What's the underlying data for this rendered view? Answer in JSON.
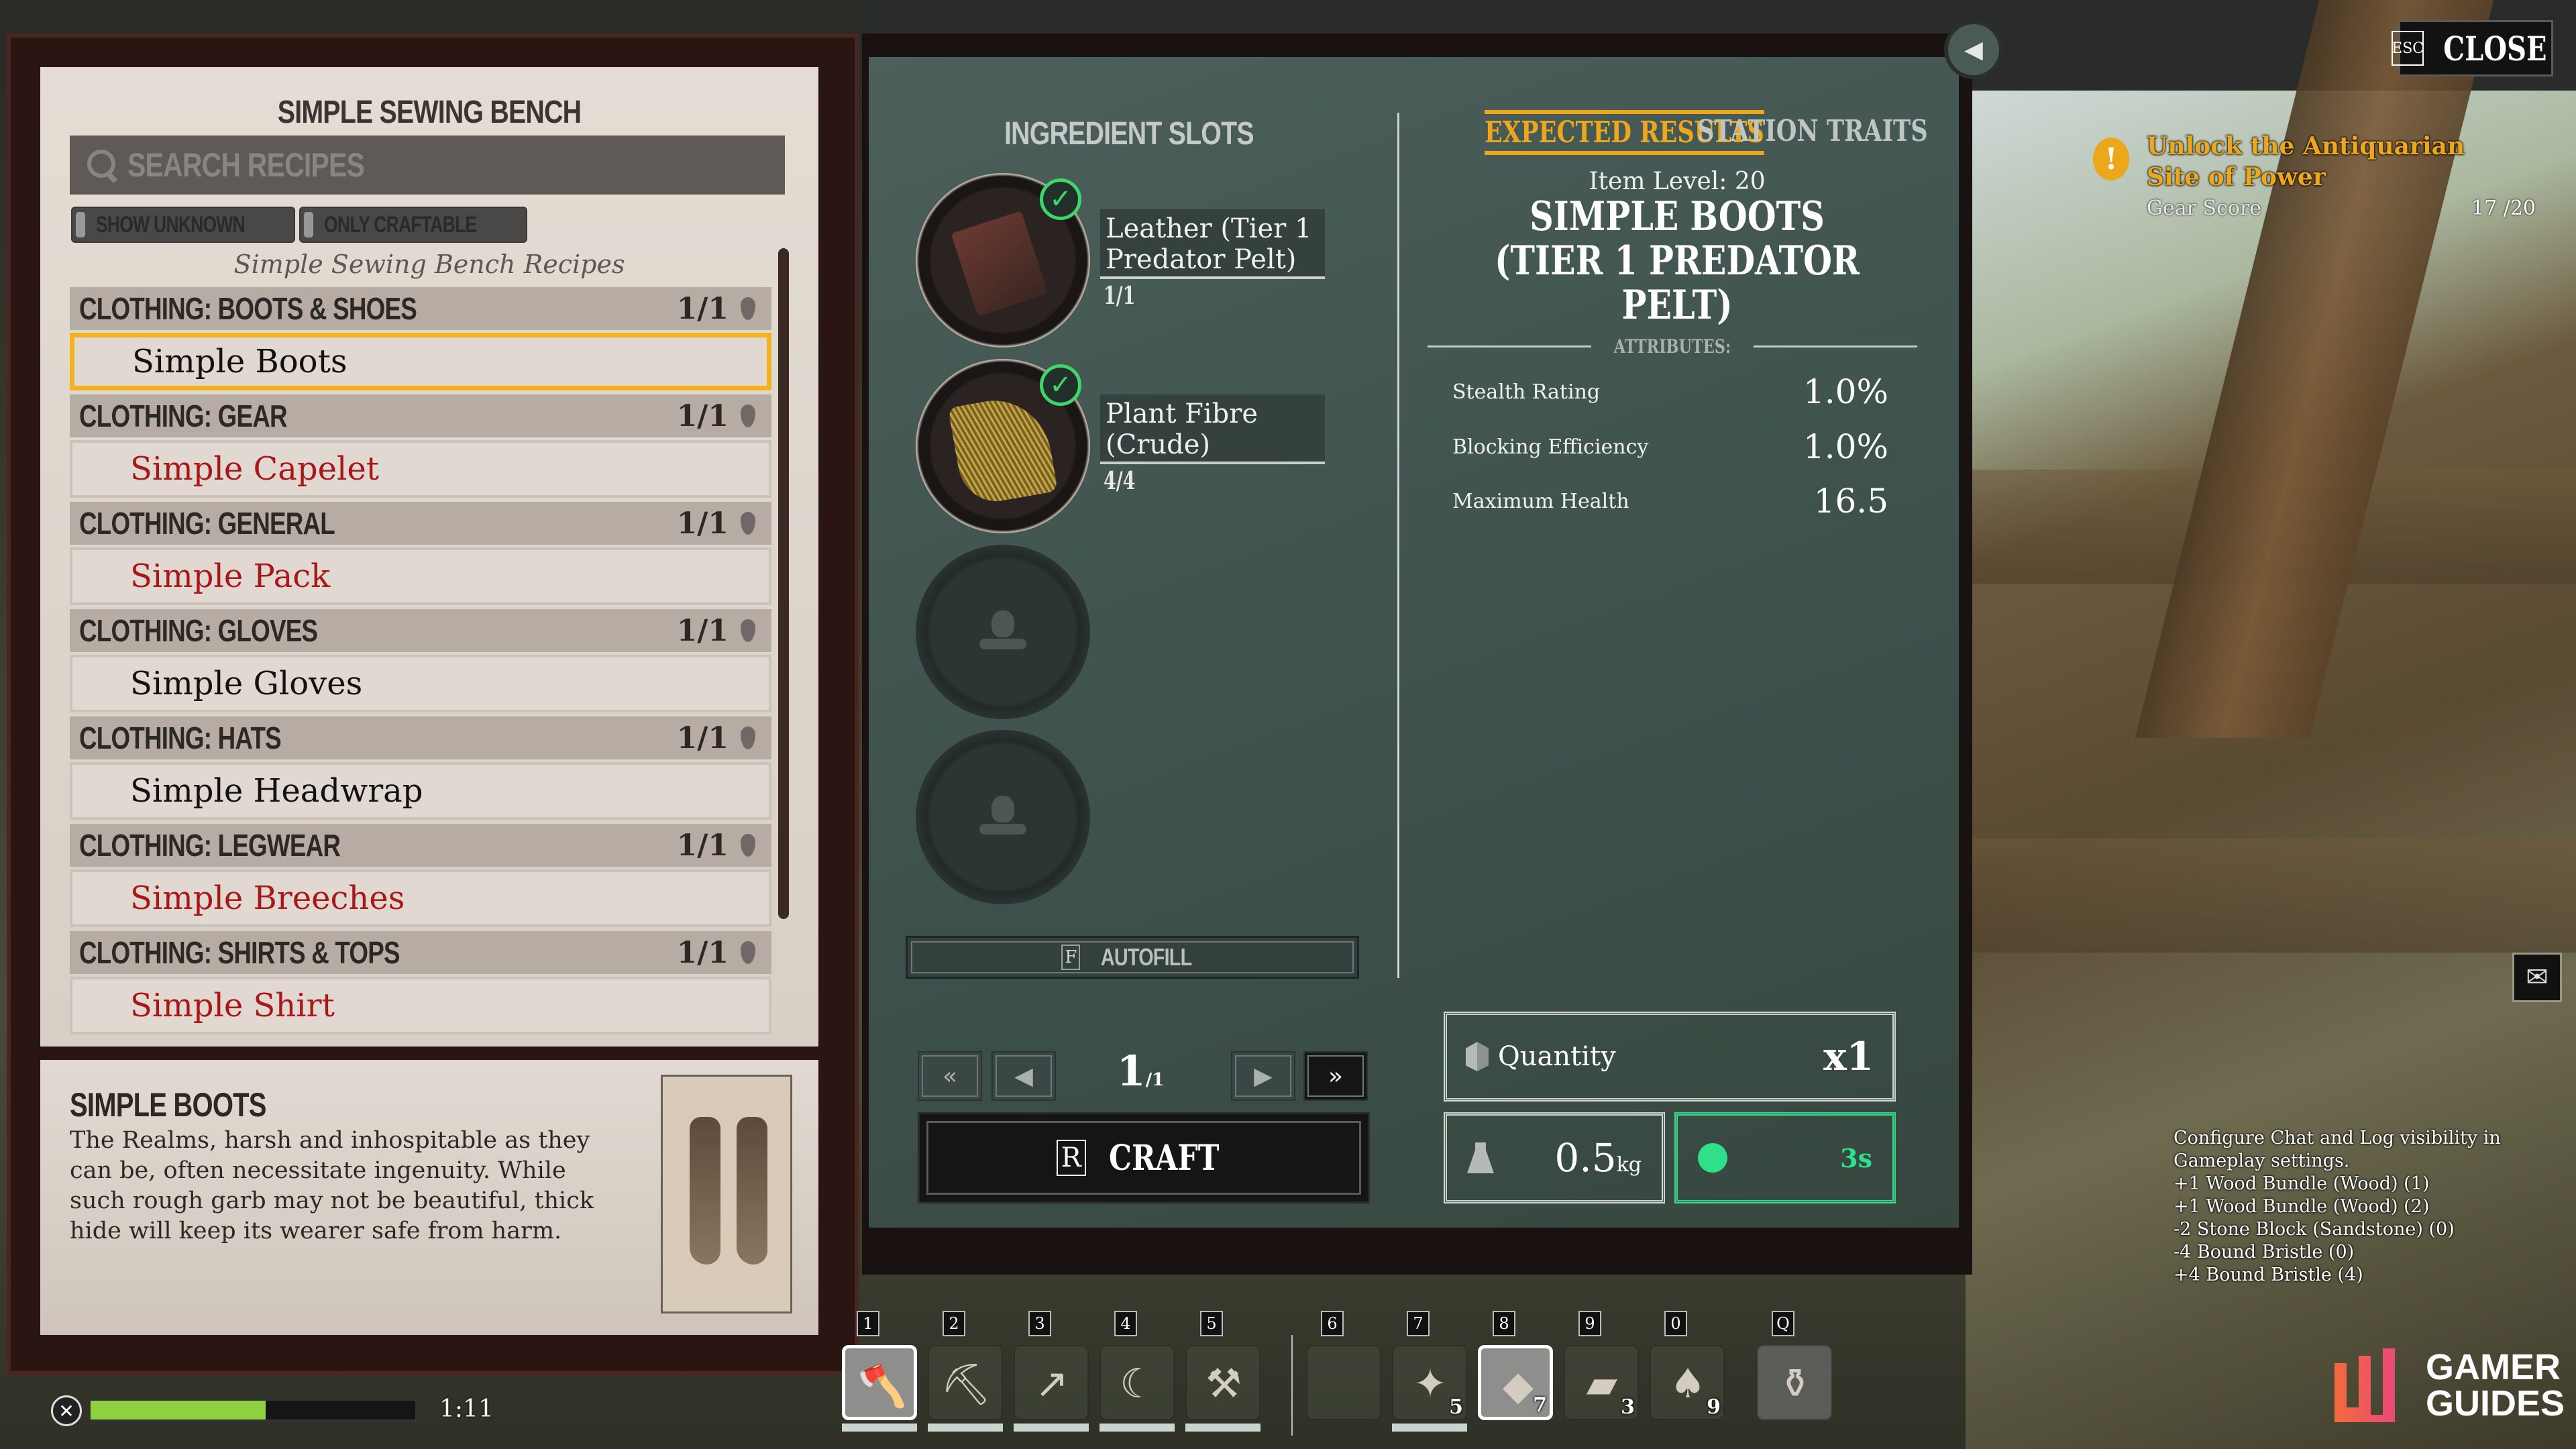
{
  "left": {
    "title": "SIMPLE SEWING BENCH",
    "search_placeholder": "SEARCH RECIPES",
    "toggles": [
      {
        "label": "SHOW UNKNOWN",
        "checked": false
      },
      {
        "label": "ONLY CRAFTABLE",
        "checked": false
      }
    ],
    "subtitle": "Simple Sewing Bench Recipes",
    "categories": [
      {
        "name": "CLOTHING: BOOTS & SHOES",
        "count": "1/1",
        "items": [
          {
            "name": "Simple Boots",
            "craftable": true,
            "selected": true
          }
        ]
      },
      {
        "name": "CLOTHING: GEAR",
        "count": "1/1",
        "items": [
          {
            "name": "Simple Capelet",
            "craftable": false
          }
        ]
      },
      {
        "name": "CLOTHING: GENERAL",
        "count": "1/1",
        "items": [
          {
            "name": "Simple Pack",
            "craftable": false
          }
        ]
      },
      {
        "name": "CLOTHING: GLOVES",
        "count": "1/1",
        "items": [
          {
            "name": "Simple Gloves",
            "craftable": true
          }
        ]
      },
      {
        "name": "CLOTHING: HATS",
        "count": "1/1",
        "items": [
          {
            "name": "Simple Headwrap",
            "craftable": true
          }
        ]
      },
      {
        "name": "CLOTHING: LEGWEAR",
        "count": "1/1",
        "items": [
          {
            "name": "Simple Breeches",
            "craftable": false
          }
        ]
      },
      {
        "name": "CLOTHING: SHIRTS & TOPS",
        "count": "1/1",
        "items": [
          {
            "name": "Simple Shirt",
            "craftable": false
          }
        ]
      }
    ],
    "description": {
      "title": "SIMPLE BOOTS",
      "text": "The Realms, harsh and inhospitable as they can be, often necessitate ingenuity. While such rough garb may not be beautiful, thick hide will keep its wearer safe from harm."
    }
  },
  "ingredients": {
    "heading": "INGREDIENT SLOTS",
    "slots": [
      {
        "name": "Leather (Tier 1 Predator Pelt)",
        "count": "1/1",
        "filled": true,
        "icon": "leather-icon"
      },
      {
        "name": "Plant Fibre (Crude)",
        "count": "4/4",
        "filled": true,
        "icon": "plant-fibre-icon"
      },
      {
        "filled": false,
        "icon": "bag-hand-icon"
      },
      {
        "filled": false,
        "icon": "bag-hand-icon"
      }
    ],
    "autofill": {
      "key": "F",
      "label": "AUTOFILL"
    },
    "pager": {
      "current": "1",
      "total": "1",
      "first": "«",
      "prev": "◀",
      "next": "▶",
      "last": "»"
    },
    "craft": {
      "key": "R",
      "label": "CRAFT"
    }
  },
  "results": {
    "tabs": [
      {
        "label": "EXPECTED RESULTS",
        "active": true
      },
      {
        "label": "STATION TRAITS",
        "active": false
      }
    ],
    "item_level": "Item Level: 20",
    "item_name": "SIMPLE BOOTS (TIER 1 PREDATOR PELT)",
    "attributes_label": "ATTRIBUTES:",
    "attributes": [
      {
        "name": "Stealth Rating",
        "value": "1.0%"
      },
      {
        "name": "Blocking Efficiency",
        "value": "1.0%"
      },
      {
        "name": "Maximum Health",
        "value": "16.5"
      }
    ],
    "quantity": {
      "label": "Quantity",
      "value": "x1"
    },
    "weight": {
      "value": "0.5",
      "unit": "kg"
    },
    "time": {
      "value": "3s"
    },
    "accent_color": "#eca71c",
    "time_color": "#2ee08a"
  },
  "top_right": {
    "back_glyph": "◀",
    "close": {
      "key": "ESC",
      "label": "CLOSE"
    },
    "quest": {
      "icon": "!",
      "title": "Unlock the Antiquarian Site of Power",
      "objective": "Gear Score",
      "progress": "17 /20"
    },
    "mail_glyph": "✉"
  },
  "log": {
    "lines": [
      "Configure Chat and Log visibility in Gameplay settings.",
      "+1 Wood Bundle (Wood) (1)",
      "+1 Wood Bundle (Wood) (2)",
      "-2 Stone Block (Sandstone) (0)",
      "-4 Bound Bristle (0)",
      "+4 Bound Bristle (4)"
    ]
  },
  "hotbar": {
    "slots": [
      {
        "key": "1",
        "icon": "axe-icon",
        "glyph": "🪓",
        "qty": "",
        "durability": true,
        "selected": true
      },
      {
        "key": "2",
        "icon": "pickaxe-icon",
        "glyph": "⛏",
        "qty": "",
        "durability": true
      },
      {
        "key": "3",
        "icon": "spear-icon",
        "glyph": "↗",
        "qty": "",
        "durability": true
      },
      {
        "key": "4",
        "icon": "sickle-icon",
        "glyph": "☾",
        "qty": "",
        "durability": true
      },
      {
        "key": "5",
        "icon": "hammer-icon",
        "glyph": "⚒",
        "qty": "",
        "durability": true
      },
      {
        "key": "6",
        "icon": "empty-slot-icon",
        "glyph": "",
        "qty": "",
        "durability": false
      },
      {
        "key": "7",
        "icon": "torch-icon",
        "glyph": "✦",
        "qty": "5",
        "durability": true
      },
      {
        "key": "8",
        "icon": "meat-icon",
        "glyph": "◆",
        "qty": "7",
        "durability": false,
        "selected": true
      },
      {
        "key": "9",
        "icon": "map-scrap-icon",
        "glyph": "▰",
        "qty": "3",
        "durability": false
      },
      {
        "key": "0",
        "icon": "mushroom-icon",
        "glyph": "♠",
        "qty": "9",
        "durability": false
      },
      {
        "key": "Q",
        "icon": "potion-icon",
        "glyph": "⚱",
        "qty": "",
        "durability": false,
        "potion": true
      }
    ]
  },
  "status": {
    "food_glyph": "✕",
    "food_fill": 0.54,
    "food_time": "1:11"
  },
  "logo": {
    "line1": "GAMER",
    "line2": "GUIDES"
  }
}
